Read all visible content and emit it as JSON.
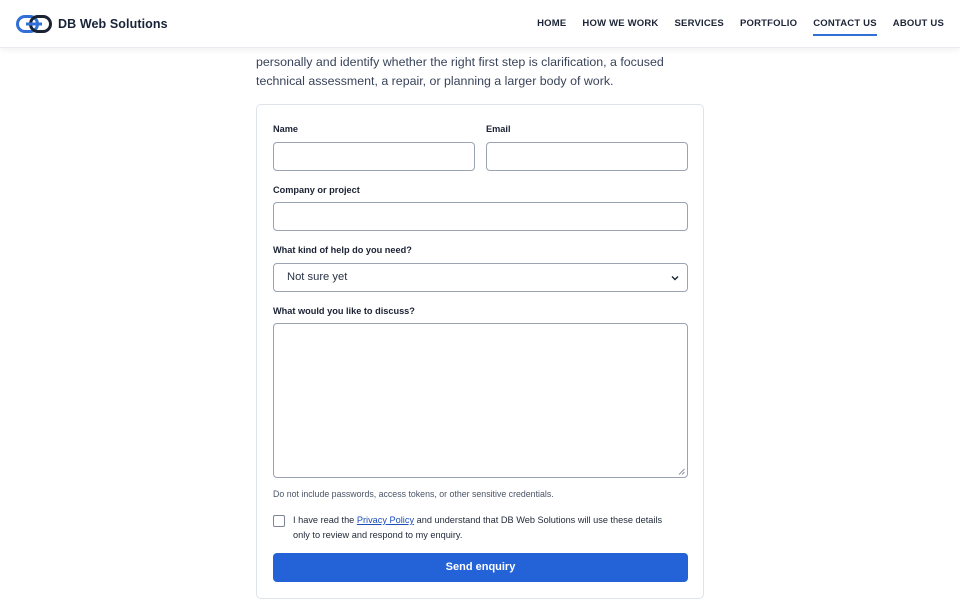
{
  "header": {
    "brand_name": "DB Web Solutions",
    "logo_icon": "db-link-logo",
    "nav": [
      {
        "label": "HOME",
        "active": false
      },
      {
        "label": "HOW WE WORK",
        "active": false
      },
      {
        "label": "SERVICES",
        "active": false
      },
      {
        "label": "PORTFOLIO",
        "active": false
      },
      {
        "label": "CONTACT US",
        "active": true
      },
      {
        "label": "ABOUT US",
        "active": false
      }
    ]
  },
  "intro": {
    "line_partial": "personally and identify whether the right first step is clarification, a focused",
    "line_3": "technical assessment, a repair, or planning a larger body of work."
  },
  "form": {
    "name_label": "Name",
    "name_value": "",
    "email_label": "Email",
    "email_value": "",
    "company_label": "Company or project",
    "company_value": "",
    "help_label": "What kind of help do you need?",
    "help_selected": "Not sure yet",
    "discuss_label": "What would you like to discuss?",
    "discuss_value": "",
    "hint": "Do not include passwords, access tokens, or other sensitive credentials.",
    "consent_before": "I have read the ",
    "consent_link": "Privacy Policy",
    "consent_after": " and understand that DB Web Solutions will use these details only to review and respond to my enquiry.",
    "consent_checked": false,
    "submit_label": "Send enquiry"
  },
  "colors": {
    "accent": "#2462d8",
    "link": "#1d4fb8",
    "nav_active_underline": "#2f6fd6"
  }
}
